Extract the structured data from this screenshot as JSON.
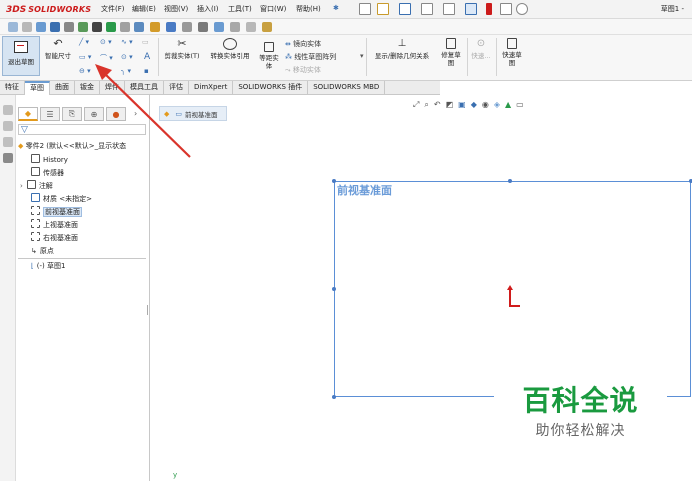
{
  "app": {
    "brand_prefix": "3DS",
    "brand_name": "SOLIDWORKS",
    "document_title": "草图1 -"
  },
  "menu": [
    {
      "label": "文件(F)"
    },
    {
      "label": "编辑(E)"
    },
    {
      "label": "视图(V)"
    },
    {
      "label": "插入(I)"
    },
    {
      "label": "工具(T)"
    },
    {
      "label": "窗口(W)"
    },
    {
      "label": "帮助(H)"
    }
  ],
  "command_manager": {
    "exit_sketch": "退出草图",
    "smart_dimension": "智能尺寸",
    "trim_entities": "剪裁实体(T)",
    "convert_entities": "转换实体引用",
    "offset_entities_1": "等距实",
    "offset_entities_2": "体",
    "mirror_entities": "镜向实体",
    "linear_pattern": "线性草图阵列",
    "move_entities": "移动实体",
    "display_relations": "显示/删除几何关系",
    "repair_sketch_1": "修复草",
    "repair_sketch_2": "图",
    "quick_snaps": "快速...",
    "rapid_sketch_1": "快速草",
    "rapid_sketch_2": "图"
  },
  "tabs": [
    {
      "label": "特征"
    },
    {
      "label": "草图"
    },
    {
      "label": "曲面"
    },
    {
      "label": "钣金"
    },
    {
      "label": "焊件"
    },
    {
      "label": "模具工具"
    },
    {
      "label": "评估"
    },
    {
      "label": "DimXpert"
    },
    {
      "label": "SOLIDWORKS 插件"
    },
    {
      "label": "SOLIDWORKS MBD"
    }
  ],
  "active_tab_index": 1,
  "feature_tree": {
    "root": "零件2 (默认<<默认>_显示状态",
    "items": [
      {
        "label": "History"
      },
      {
        "label": "传感器"
      },
      {
        "label": "注解"
      },
      {
        "label": "材质 <未指定>"
      },
      {
        "label": "前视基准面"
      },
      {
        "label": "上视基准面"
      },
      {
        "label": "右视基准面"
      },
      {
        "label": "原点"
      },
      {
        "label": "(-) 草图1"
      }
    ]
  },
  "graphics": {
    "breadcrumb_label": "前视基准面",
    "plane_label": "前视基准面"
  },
  "watermark": {
    "title": "百科全说",
    "subtitle": "助你轻松解决"
  },
  "colors": {
    "accent_blue": "#5b8fd6",
    "origin_red": "#d01c1c",
    "brand_red": "#cc1b1b",
    "watermark_green": "#1a9a3f",
    "annotation_arrow": "#d9342b"
  }
}
